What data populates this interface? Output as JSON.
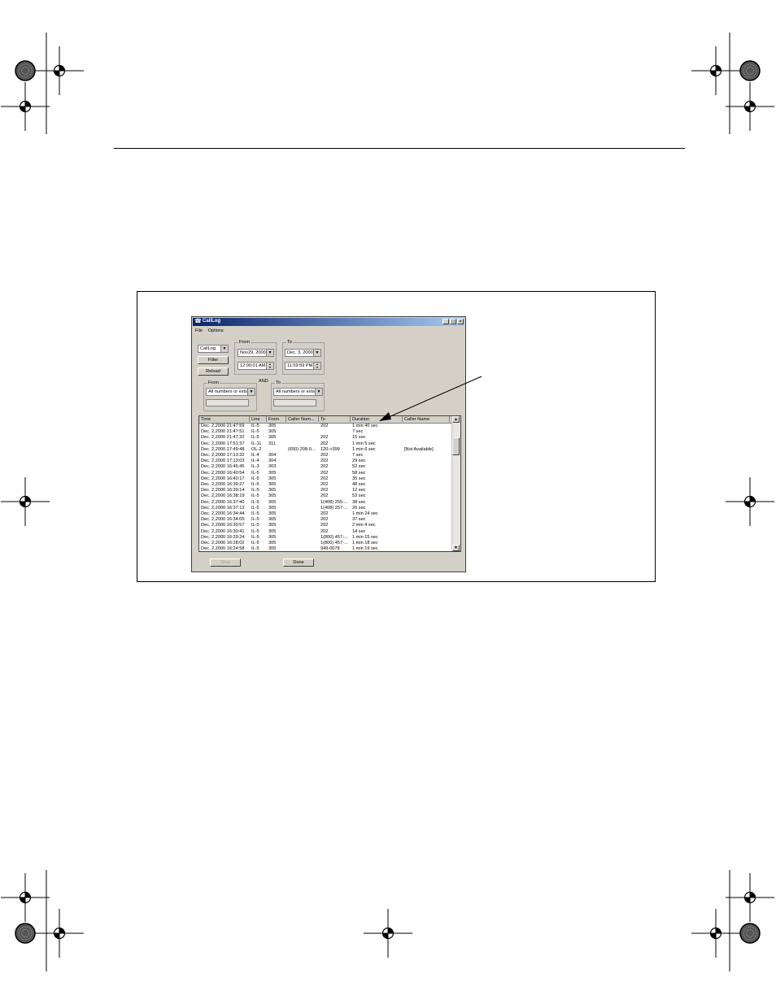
{
  "window": {
    "title": "CallLog",
    "title_icon": "phone-log-icon",
    "controls": {
      "minimize": "_",
      "maximize": "□",
      "close": "×"
    },
    "menu": [
      "File",
      "Options"
    ]
  },
  "controls": {
    "log_select": "CallLog",
    "filter_label": "Filter",
    "reload_label": "Reload",
    "date_from": {
      "legend": "From",
      "date": "Nov29, 2000",
      "time": "12:00:01 AM"
    },
    "date_to": {
      "legend": "To",
      "date": "Dec. 3, 2000",
      "time": "11:59:59 PM"
    },
    "number_from": {
      "legend": "From",
      "value": "All numbers or exts"
    },
    "and_label": "AND",
    "number_to": {
      "legend": "To",
      "value": "All numbers or exts"
    }
  },
  "table": {
    "columns": [
      "Time",
      "Line",
      "From",
      "Caller Num...",
      "To",
      "Duration",
      "Caller Name"
    ],
    "rows": [
      [
        "Dec. 2,2000 21:47:59",
        "IL-5",
        "305",
        "",
        "202",
        "1 min 40 sec",
        ""
      ],
      [
        "Dec. 2,2000 21:47:51",
        "IL-5",
        "305",
        "",
        "",
        "7 sec",
        ""
      ],
      [
        "Dec. 2,2000 21:47:32",
        "IL-5",
        "305",
        "",
        "202",
        "15 sec",
        ""
      ],
      [
        "Dec. 2,2000 17:51:37",
        "IL-11",
        "311",
        "",
        "202",
        "1 min 5 sec",
        ""
      ],
      [
        "Dec. 2,2000 17:49:48",
        "OL-2",
        "",
        "(650) 208-0...",
        "120->399",
        "1 min 6 sec",
        "[Not Available]"
      ],
      [
        "Dec. 2,2000 17:13:32",
        "IL-4",
        "304",
        "",
        "202",
        "7 sec",
        ""
      ],
      [
        "Dec. 2,2000 17:13:03",
        "IL-4",
        "304",
        "",
        "202",
        "29 sec",
        ""
      ],
      [
        "Dec. 2,2000 16:46:45",
        "IL-3",
        "303",
        "",
        "202",
        "52 sec",
        ""
      ],
      [
        "Dec. 2,2000 16:40:54",
        "IL-5",
        "305",
        "",
        "202",
        "58 sec",
        ""
      ],
      [
        "Dec. 2,2000 16:40:17",
        "IL-5",
        "305",
        "",
        "202",
        "35 sec",
        ""
      ],
      [
        "Dec. 2,2000 16:39:27",
        "IL-5",
        "305",
        "",
        "202",
        "48 sec",
        ""
      ],
      [
        "Dec. 2,2000 16:39:14",
        "IL-5",
        "305",
        "",
        "202",
        "12 sec",
        ""
      ],
      [
        "Dec. 2,2000 16:38:19",
        "IL-5",
        "305",
        "",
        "202",
        "53 sec",
        ""
      ],
      [
        "Dec. 2,2000 16:37:40",
        "IL-5",
        "305",
        "",
        "1(408) 255-...",
        "38 sec",
        ""
      ],
      [
        "Dec. 2,2000 16:37:13",
        "IL-5",
        "305",
        "",
        "1(408) 257-...",
        "26 sec",
        ""
      ],
      [
        "Dec. 2,2000 16:34:44",
        "IL-5",
        "305",
        "",
        "202",
        "1 min 24 sec",
        ""
      ],
      [
        "Dec. 2,2000 16:34:05",
        "IL-5",
        "305",
        "",
        "202",
        "37 sec",
        ""
      ],
      [
        "Dec. 2,2000 16:30:57",
        "IL-5",
        "305",
        "",
        "202",
        "2 min 4 sec",
        ""
      ],
      [
        "Dec. 2,2000 16:30:41",
        "IL-5",
        "305",
        "",
        "202",
        "14 sec",
        ""
      ],
      [
        "Dec. 2,2000 16:29:24",
        "IL-5",
        "305",
        "",
        "1(800) 457-...",
        "1 min 15 sec",
        ""
      ],
      [
        "Dec. 2,2000 16:28:02",
        "IL-5",
        "305",
        "",
        "1(800) 457-...",
        "1 min 18 sec",
        ""
      ],
      [
        "Dec. 2,2000 16:24:58",
        "IL-5",
        "305",
        "",
        "949-0078",
        "1 min 19 sec",
        ""
      ]
    ]
  },
  "footer": {
    "stop_label": "Stop",
    "done_label": "Done"
  }
}
